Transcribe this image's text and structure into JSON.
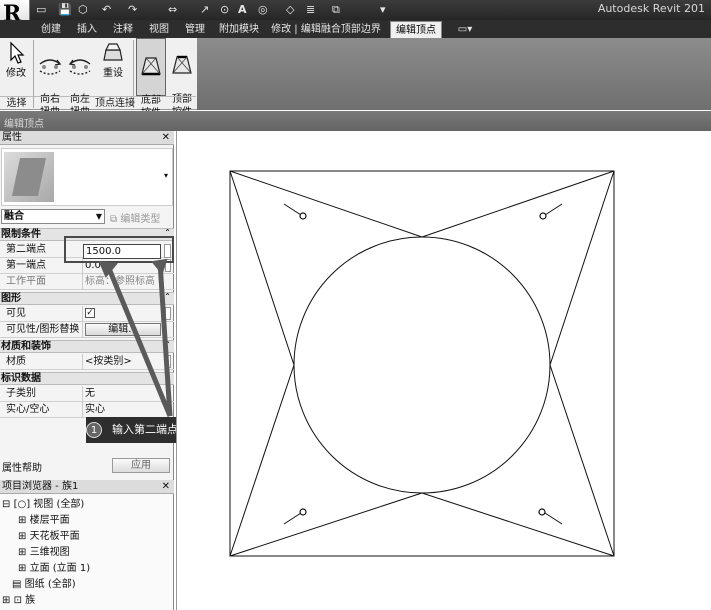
{
  "titlebar": {
    "app_title": "Autodesk Revit 201",
    "qat_glyphs": [
      "▭",
      "💾",
      "⬡",
      "↶",
      "↷",
      "⇔",
      "↗",
      "⊙",
      "A",
      "◎",
      "◇",
      "≣",
      "⧉",
      "▾"
    ]
  },
  "tabs": [
    "创建",
    "插入",
    "注释",
    "视图",
    "管理",
    "附加模块",
    "修改 | 编辑融合顶部边界",
    "编辑顶点",
    "▭▾"
  ],
  "ribbon": {
    "modify_label": "修改",
    "twist_right_label": "向右\n扭曲",
    "twist_left_label": "向左\n扭曲",
    "reset_label": "重设",
    "bottom_ctrl_label": "底部\n控件",
    "top_ctrl_label": "顶部\n控件",
    "panel_select": "选择",
    "panel_vertex": "顶点连接"
  },
  "options_bar": "编辑顶点",
  "properties": {
    "title": "属性",
    "close": "✕",
    "type_selector": "融合",
    "edit_type": "编辑类型",
    "groups": {
      "constraints": "限制条件",
      "graphics": "图形",
      "materials": "材质和装饰",
      "identity": "标识数据"
    },
    "rows": {
      "second_end_label": "第二端点",
      "second_end_value": "1500.0",
      "first_end_label": "第一端点",
      "first_end_value": "0.0",
      "work_plane_label": "工作平面",
      "work_plane_value": "标高：参照标高",
      "visible_label": "可见",
      "visible_value": "✓",
      "vis_override_label": "可见性/图形替换",
      "vis_override_button": "编辑...",
      "material_label": "材质",
      "material_value": "<按类别>",
      "subcategory_label": "子类别",
      "subcategory_value": "无",
      "solid_void_label": "实心/空心",
      "solid_void_value": "实心"
    },
    "help_link": "属性帮助",
    "apply_button": "应用"
  },
  "callout": {
    "number": "1",
    "text": "输入第二端点高度"
  },
  "browser": {
    "title": "项目浏览器 - 族1",
    "items": [
      {
        "label": "视图 (全部)",
        "expander": "⊟",
        "icon": "[○]"
      },
      {
        "label": "楼层平面",
        "expander": "⊞"
      },
      {
        "label": "天花板平面",
        "expander": "⊞"
      },
      {
        "label": "三维视图",
        "expander": "⊞"
      },
      {
        "label": "立面 (立面 1)",
        "expander": "⊞"
      },
      {
        "label": "图纸 (全部)",
        "expander": "",
        "icon": "▤"
      },
      {
        "label": "族",
        "expander": "⊞",
        "icon": "⊡"
      }
    ]
  }
}
